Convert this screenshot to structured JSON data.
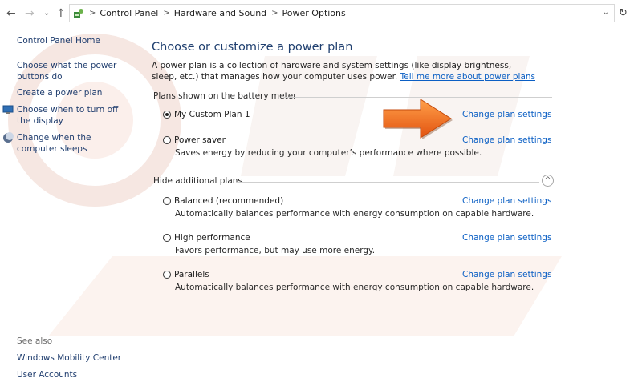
{
  "address_bar": {
    "breadcrumb": [
      "Control Panel",
      "Hardware and Sound",
      "Power Options"
    ]
  },
  "sidebar": {
    "home": "Control Panel Home",
    "tasks": [
      "Choose what the power buttons do",
      "Create a power plan",
      "Choose when to turn off the display",
      "Change when the computer sleeps"
    ],
    "see_also_label": "See also",
    "see_also": [
      "Windows Mobility Center",
      "User Accounts"
    ]
  },
  "main": {
    "title": "Choose or customize a power plan",
    "description": "A power plan is a collection of hardware and system settings (like display brightness, sleep, etc.) that manages how your computer uses power.",
    "description_link": "Tell me more about power plans",
    "section_shown": "Plans shown on the battery meter",
    "section_hidden": "Hide additional plans",
    "change_link": "Change plan settings",
    "plans_shown": [
      {
        "name": "My Custom Plan 1",
        "selected": true,
        "description": ""
      },
      {
        "name": "Power saver",
        "selected": false,
        "description": "Saves energy by reducing your computer’s performance where possible."
      }
    ],
    "plans_hidden": [
      {
        "name": "Balanced (recommended)",
        "selected": false,
        "description": "Automatically balances performance with energy consumption on capable hardware."
      },
      {
        "name": "High performance",
        "selected": false,
        "description": "Favors performance, but may use more energy."
      },
      {
        "name": "Parallels",
        "selected": false,
        "description": "Automatically balances performance with energy consumption on capable hardware."
      }
    ]
  },
  "colors": {
    "link": "#0b5fc4",
    "title": "#1f3f6f",
    "annotation_arrow": "#f26a1b"
  },
  "icons": [
    "back-arrow-icon",
    "forward-arrow-icon",
    "recent-locations-icon",
    "up-arrow-icon",
    "control-panel-icon",
    "refresh-icon",
    "display-icon",
    "moon-icon",
    "expand-arrow-icon",
    "orange-arrow-icon"
  ]
}
